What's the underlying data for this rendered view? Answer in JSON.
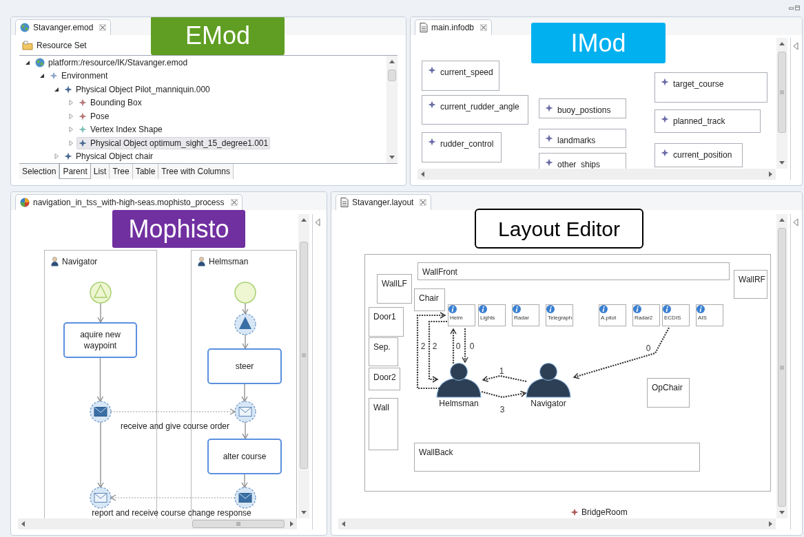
{
  "emod_editor": {
    "tab_title": "Stavanger.emod",
    "badge": "EMod",
    "resource_set": "Resource Set",
    "tree": [
      {
        "kind": "resource",
        "label": "platform:/resource/IK/Stavanger.emod",
        "expanded": true,
        "selected": false,
        "children": [
          {
            "kind": "object",
            "label": "Environment",
            "color": "#8aa6c8",
            "expanded": true,
            "selected": false,
            "children": [
              {
                "kind": "object",
                "label": "Physical Object Pilot_manniquin.000",
                "color": "#4a6a94",
                "expanded": true,
                "selected": false,
                "children": [
                  {
                    "kind": "object",
                    "label": "Bounding Box",
                    "color": "#b87878",
                    "expanded": false,
                    "selected": false
                  },
                  {
                    "kind": "object",
                    "label": "Pose",
                    "color": "#b87878",
                    "expanded": false,
                    "selected": false
                  },
                  {
                    "kind": "object",
                    "label": "Vertex Index Shape",
                    "color": "#7cc0b8",
                    "expanded": false,
                    "selected": false
                  },
                  {
                    "kind": "object",
                    "label": "Physical Object optimum_sight_15_degree1.001",
                    "color": "#4a6a94",
                    "expanded": false,
                    "selected": true
                  }
                ]
              },
              {
                "kind": "object",
                "label": "Physical Object chair",
                "color": "#4a6a94",
                "expanded": false,
                "selected": false
              }
            ]
          }
        ]
      }
    ],
    "bottom_tabs": [
      {
        "label": "Selection",
        "selected": false
      },
      {
        "label": "Parent",
        "selected": true
      },
      {
        "label": "List",
        "selected": false
      },
      {
        "label": "Tree",
        "selected": false
      },
      {
        "label": "Table",
        "selected": false
      },
      {
        "label": "Tree with Columns",
        "selected": false
      }
    ]
  },
  "imod_editor": {
    "tab_title": "main.infodb",
    "badge": "IMod",
    "items": [
      {
        "label": "current_speed"
      },
      {
        "label": "current_rudder_angle"
      },
      {
        "label": "rudder_control"
      },
      {
        "label": "buoy_postions"
      },
      {
        "label": "landmarks"
      },
      {
        "label": "other_ships"
      },
      {
        "label": "target_course"
      },
      {
        "label": "planned_track"
      },
      {
        "label": "current_position"
      }
    ]
  },
  "process_editor": {
    "tab_title": "navigation_in_tss_with-high-seas.mophisto_process",
    "badge": "Mophisto",
    "lanes": [
      {
        "label": "Navigator"
      },
      {
        "label": "Helmsman"
      }
    ],
    "nodes": [
      {
        "kind": "start_signal"
      },
      {
        "kind": "task",
        "label": "aquire new waypoint"
      },
      {
        "kind": "message_send"
      },
      {
        "kind": "message_receive"
      },
      {
        "kind": "start"
      },
      {
        "kind": "signal_send"
      },
      {
        "kind": "task",
        "label": "steer"
      },
      {
        "kind": "message_receive"
      },
      {
        "kind": "task",
        "label": "alter course"
      },
      {
        "kind": "message_send"
      }
    ],
    "message_flows": [
      {
        "label": "receive and give course order"
      },
      {
        "label": "report and receive course change response"
      }
    ]
  },
  "layout_editor": {
    "tab_title": "Stavanger.layout",
    "badge": "Layout Editor",
    "elements": [
      {
        "kind": "box",
        "label": "WallLF"
      },
      {
        "kind": "box",
        "label": "WallFront"
      },
      {
        "kind": "box",
        "label": "WallRF"
      },
      {
        "kind": "box",
        "label": "Chair"
      },
      {
        "kind": "box",
        "label": "Door1"
      },
      {
        "kind": "device",
        "label": "Helm"
      },
      {
        "kind": "device",
        "label": "Lights"
      },
      {
        "kind": "device",
        "label": "Radar"
      },
      {
        "kind": "device",
        "label": "Telegraph"
      },
      {
        "kind": "device",
        "label": "A.pilot"
      },
      {
        "kind": "device",
        "label": "Radar2"
      },
      {
        "kind": "device",
        "label": "ECDIS"
      },
      {
        "kind": "device",
        "label": "AIS"
      },
      {
        "kind": "box",
        "label": "Sep."
      },
      {
        "kind": "box",
        "label": "Door2"
      },
      {
        "kind": "box",
        "label": "Wall"
      },
      {
        "kind": "person",
        "label": "Helmsman"
      },
      {
        "kind": "person",
        "label": "Navigator"
      },
      {
        "kind": "box",
        "label": "OpChair"
      },
      {
        "kind": "box",
        "label": "WallBack"
      }
    ],
    "connections": [
      {
        "label": "2"
      },
      {
        "label": "2"
      },
      {
        "label": "0"
      },
      {
        "label": "0"
      },
      {
        "label": "1"
      },
      {
        "label": "3"
      },
      {
        "label": "0"
      }
    ],
    "room_label": "BridgeRoom"
  }
}
